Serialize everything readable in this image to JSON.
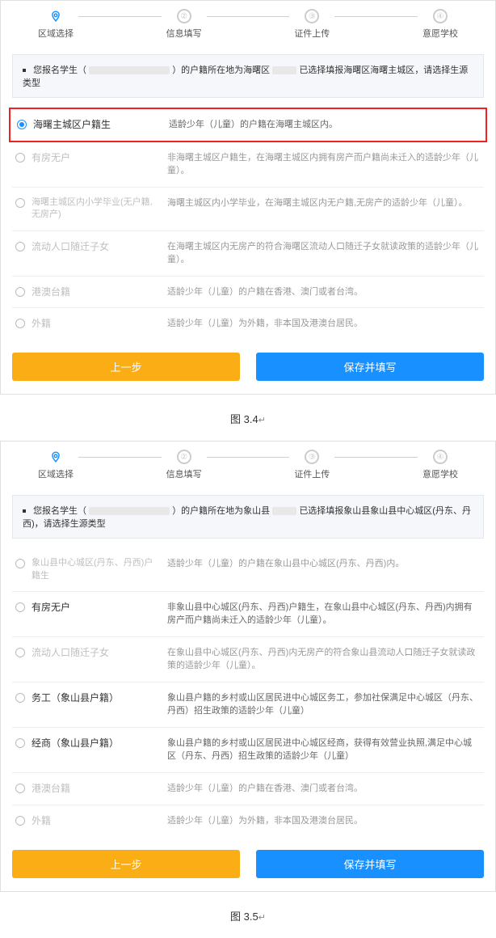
{
  "stepper": [
    {
      "num": "",
      "label": "区域选择",
      "active": true,
      "icon": "loc"
    },
    {
      "num": "②",
      "label": "信息填写",
      "active": false
    },
    {
      "num": "③",
      "label": "证件上传",
      "active": false
    },
    {
      "num": "④",
      "label": "意愿学校",
      "active": false
    }
  ],
  "card1": {
    "notice_pre": "您报名学生（",
    "notice_mid": "）的户籍所在地为海曙区",
    "notice_post": "已选择填报海曙区海曙主城区，请选择生源类型",
    "options": [
      {
        "label": "海曙主城区户籍生",
        "desc": "适龄少年（儿童）的户籍在海曙主城区内。",
        "highlight": true,
        "checked": true,
        "dim": false,
        "darkdesc": true
      },
      {
        "label": "有房无户",
        "desc": "非海曙主城区户籍生，在海曙主城区内拥有房产而户籍尚未迁入的适龄少年（儿童）。",
        "dim": true
      },
      {
        "label": "海曙主城区内小学毕业(无户籍,无房产)",
        "desc": "海曙主城区内小学毕业，在海曙主城区内无户籍,无房产的适龄少年（儿童）。",
        "dim": true,
        "small": true
      },
      {
        "label": "流动人口随迁子女",
        "desc": "在海曙主城区内无房产的符合海曙区流动人口随迁子女就读政策的适龄少年（儿童）。",
        "dim": true
      },
      {
        "label": "港澳台籍",
        "desc": "适龄少年（儿童）的户籍在香港、澳门或者台湾。",
        "dim": true
      },
      {
        "label": "外籍",
        "desc": "适龄少年（儿童）为外籍，非本国及港澳台居民。",
        "dim": true
      }
    ],
    "prev": "上一步",
    "next": "保存并填写"
  },
  "caption1": "图 3.4",
  "card2": {
    "notice_pre": "您报名学生（",
    "notice_mid": "）的户籍所在地为象山县",
    "notice_post": "已选择填报象山县象山县中心城区(丹东、丹西)，请选择生源类型",
    "options": [
      {
        "label": "象山县中心城区(丹东、丹西)户籍生",
        "desc": "适龄少年（儿童）的户籍在象山县中心城区(丹东、丹西)内。",
        "dim": true,
        "small": true
      },
      {
        "label": "有房无户",
        "desc": "非象山县中心城区(丹东、丹西)户籍生，在象山县中心城区(丹东、丹西)内拥有房产而户籍尚未迁入的适龄少年（儿童）。",
        "dim": false,
        "darkdesc": true
      },
      {
        "label": "流动人口随迁子女",
        "desc": "在象山县中心城区(丹东、丹西)内无房产的符合象山县流动人口随迁子女就读政策的适龄少年（儿童）。",
        "dim": true
      },
      {
        "label": "务工（象山县户籍）",
        "desc": "象山县户籍的乡村或山区居民进中心城区务工，参加社保满足中心城区（丹东、丹西）招生政策的适龄少年（儿童）",
        "dim": false,
        "darkdesc": true
      },
      {
        "label": "经商（象山县户籍）",
        "desc": "象山县户籍的乡村或山区居民进中心城区经商，获得有效营业执照,满足中心城区（丹东、丹西）招生政策的适龄少年（儿童）",
        "dim": false,
        "darkdesc": true
      },
      {
        "label": "港澳台籍",
        "desc": "适龄少年（儿童）的户籍在香港、澳门或者台湾。",
        "dim": true
      },
      {
        "label": "外籍",
        "desc": "适龄少年（儿童）为外籍，非本国及港澳台居民。",
        "dim": true
      }
    ],
    "prev": "上一步",
    "next": "保存并填写"
  },
  "caption2": "图 3.5"
}
